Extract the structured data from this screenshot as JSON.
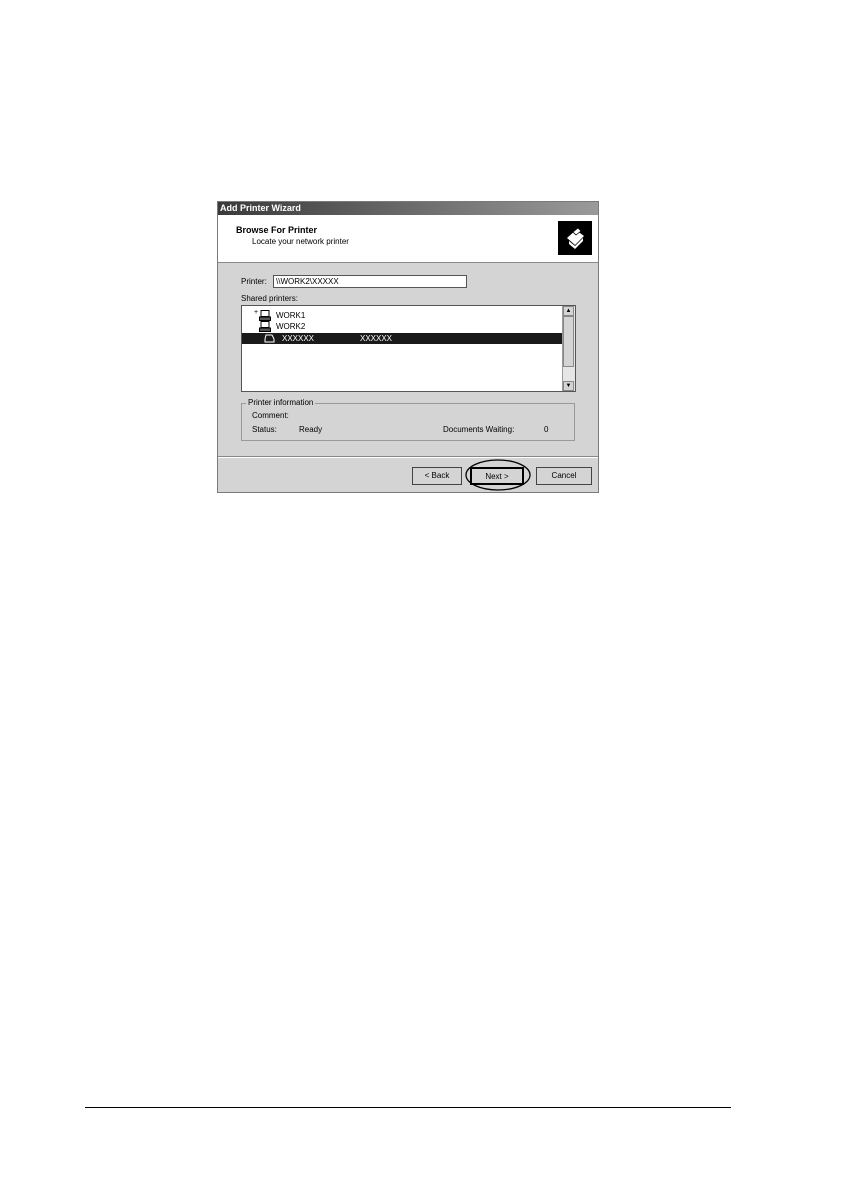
{
  "window": {
    "title": "Add Printer Wizard"
  },
  "header": {
    "title": "Browse For Printer",
    "subtitle": "Locate your network printer",
    "icon": "printer-wizard-icon"
  },
  "printer_field": {
    "label": "Printer:",
    "value": "\\\\WORK2\\XXXXX"
  },
  "shared_printers": {
    "label": "Shared printers:",
    "items": [
      {
        "name": "WORK1",
        "icon": "computer-icon",
        "selected": false
      },
      {
        "name": "WORK2",
        "icon": "computer-icon",
        "selected": false
      },
      {
        "name": "XXXXXX",
        "detail": "XXXXXX",
        "icon": "printer-icon",
        "selected": true
      }
    ]
  },
  "printer_info": {
    "title": "Printer information",
    "comment_label": "Comment:",
    "comment_value": "",
    "status_label": "Status:",
    "status_value": "Ready",
    "docs_label": "Documents Waiting:",
    "docs_value": "0"
  },
  "buttons": {
    "back": "< Back",
    "next": "Next >",
    "cancel": "Cancel"
  }
}
